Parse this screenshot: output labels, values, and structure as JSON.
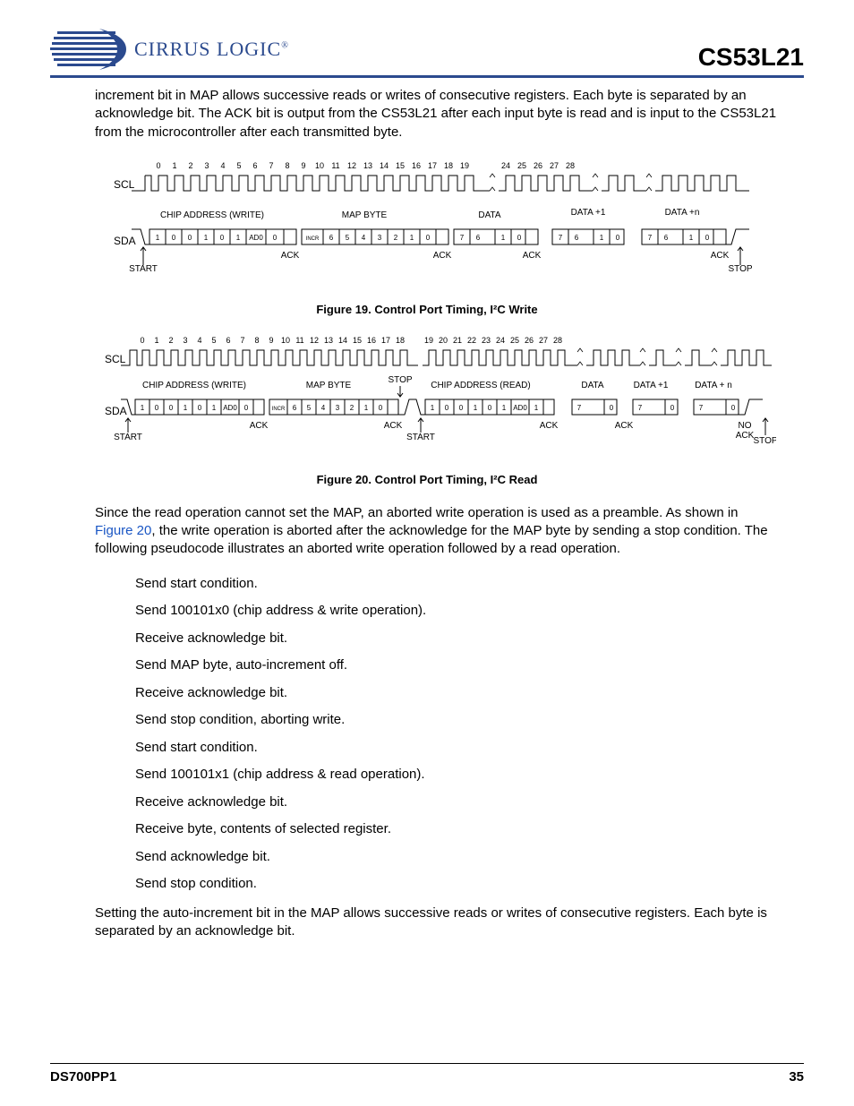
{
  "header": {
    "company": "CIRRUS LOGIC",
    "trademark": "®",
    "part": "CS53L21"
  },
  "paragraphs": {
    "intro": "increment bit in MAP allows successive reads or writes of consecutive registers. Each byte is separated by an acknowledge bit. The ACK bit is output from the CS53L21 after each input byte is read and is input to the CS53L21 from the microcontroller after each transmitted byte.",
    "mid_part1": "Since the read operation cannot set the MAP, an aborted write operation is used as a preamble. As shown in ",
    "mid_link": "Figure 20",
    "mid_part2": ", the write operation is aborted after the acknowledge for the MAP byte by sending a stop condition. The following pseudocode illustrates an aborted write operation followed by a read operation.",
    "closing": "Setting the auto-increment bit in the MAP allows successive reads or writes of consecutive registers. Each byte is separated by an acknowledge bit."
  },
  "pseudocode": [
    "Send start condition.",
    "Send 100101x0 (chip address & write operation).",
    "Receive acknowledge bit.",
    "Send MAP byte, auto-increment off.",
    "Receive acknowledge bit.",
    "Send stop condition, aborting write.",
    "Send start condition.",
    "Send 100101x1 (chip address & read operation).",
    "Receive acknowledge bit.",
    "Receive byte, contents of selected register.",
    "Send acknowledge bit.",
    "Send stop condition."
  ],
  "figures": {
    "f19": {
      "caption": "Figure 19.  Control Port Timing, I²C Write",
      "scl_label": "SCL",
      "sda_label": "SDA",
      "ticks_a": [
        "0",
        "1",
        "2",
        "3",
        "4",
        "5",
        "6",
        "7",
        "8",
        "9",
        "10",
        "11",
        "12",
        "13",
        "14",
        "15",
        "16",
        "17",
        "18",
        "19"
      ],
      "ticks_b": [
        "24",
        "25",
        "26",
        "27",
        "28"
      ],
      "labels": {
        "chip_addr": "CHIP ADDRESS (WRITE)",
        "map": "MAP BYTE",
        "data": "DATA",
        "data1": "DATA +1",
        "datan": "DATA +n",
        "incr": "INCR",
        "ack": "ACK",
        "start": "START",
        "stop": "STOP"
      },
      "byte1_bits": [
        "1",
        "0",
        "0",
        "1",
        "0",
        "1",
        "AD0",
        "0"
      ],
      "byte2_bits": [
        "6",
        "5",
        "4",
        "3",
        "2",
        "1",
        "0"
      ],
      "data_bits": [
        "7",
        "6",
        "1",
        "0"
      ]
    },
    "f20": {
      "caption": "Figure 20.  Control Port Timing, I²C Read",
      "scl_label": "SCL",
      "sda_label": "SDA",
      "ticks": [
        "0",
        "1",
        "2",
        "3",
        "4",
        "5",
        "6",
        "7",
        "8",
        "9",
        "10",
        "11",
        "12",
        "13",
        "14",
        "15",
        "16",
        "17",
        "18",
        "19",
        "20",
        "21",
        "22",
        "23",
        "24",
        "25",
        "26",
        "27",
        "28"
      ],
      "labels": {
        "chip_addr_w": "CHIP ADDRESS (WRITE)",
        "chip_addr_r": "CHIP ADDRESS (READ)",
        "map": "MAP BYTE",
        "data": "DATA",
        "data1": "DATA +1",
        "datan": "DATA + n",
        "incr": "INCR",
        "ack": "ACK",
        "noack": "NO\nACK",
        "start": "START",
        "stop": "STOP"
      },
      "byte1_bits": [
        "1",
        "0",
        "0",
        "1",
        "0",
        "1",
        "AD0",
        "0"
      ],
      "byte2_bits": [
        "6",
        "5",
        "4",
        "3",
        "2",
        "1",
        "0"
      ],
      "byte3_bits": [
        "1",
        "0",
        "0",
        "1",
        "0",
        "1",
        "AD0",
        "1"
      ],
      "data_bits": [
        "7",
        "0"
      ]
    }
  },
  "footer": {
    "docnum": "DS700PP1",
    "page": "35"
  }
}
